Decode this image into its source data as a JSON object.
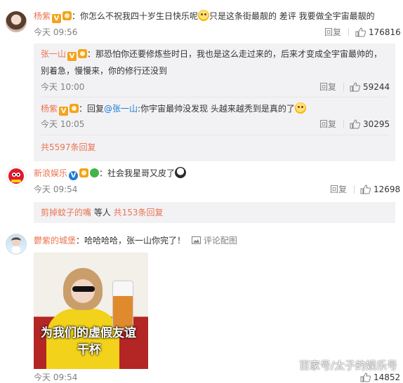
{
  "comment1": {
    "user": "杨紫",
    "text_a": "：你怎么不祝我四十岁生日快乐呢",
    "text_b": "只是这条街最靓的 差评 我要做全宇宙最靓的",
    "time": "今天 09:56",
    "reply": "回复",
    "likes": "176816",
    "replies": [
      {
        "user": "张一山",
        "text_a": "：那恐怕你还要修炼些时日，我也是这么走过来的，后来才变成全宇宙最帅的，",
        "text_b": "别着急，慢慢来，你的修行还没到",
        "time": "今天 10:00",
        "reply": "回复",
        "likes": "59244"
      },
      {
        "user": "杨紫",
        "text_a": "：回复",
        "mention": "@张一山",
        "text_b": ":你宇宙最帅没发现 头越来越秃到是真的了",
        "time": "今天 10:05",
        "reply": "回复",
        "likes": "30295"
      }
    ],
    "more": "共5597条回复"
  },
  "comment2": {
    "user": "新浪娱乐",
    "text": "：社会我星哥又皮了",
    "time": "今天 09:54",
    "reply": "回复",
    "likes": "12698",
    "sub_users": "剪掉蚊子的嘴",
    "sub_etc": " 等人 ",
    "sub_count": "共153条回复"
  },
  "comment3": {
    "user": "鬱紫的城堡",
    "text": "：哈哈哈哈，张一山你完了！",
    "pic_link": "评论配图",
    "pic_caption_1": "为我们的虚假友谊",
    "pic_caption_2": "干杯",
    "time": "今天 09:54",
    "likes": "14852"
  },
  "watermark": "百家号/太子的娱乐号",
  "icons": {
    "like": "thumbs-up-icon",
    "verified": "verified-v-icon",
    "emoji": "smile-emoji-icon",
    "picture": "picture-icon"
  },
  "colors": {
    "username": "#eb7350",
    "link": "#1d7ad9",
    "muted": "#808080"
  }
}
